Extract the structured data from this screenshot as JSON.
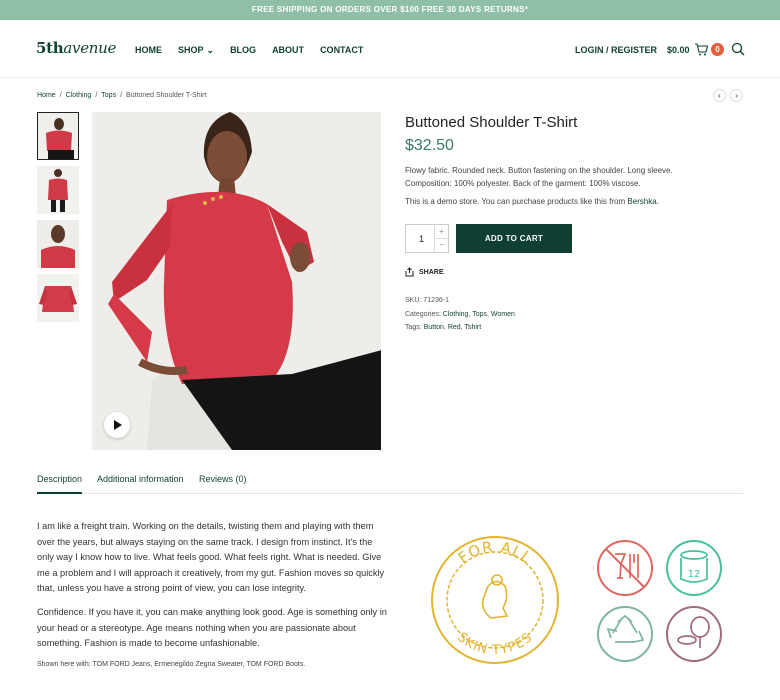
{
  "promo": "FREE SHIPPING ON ORDERS OVER $100 FREE 30 DAYS RETURNS*",
  "header": {
    "logo_main": "5th",
    "logo_italic": "avenue",
    "nav": [
      "HOME",
      "SHOP",
      "BLOG",
      "ABOUT",
      "CONTACT"
    ],
    "login": "LOGIN / REGISTER",
    "cart_total": "$0.00",
    "cart_count": "0"
  },
  "breadcrumb": {
    "items": [
      "Home",
      "Clothing",
      "Tops"
    ],
    "current": "Buttoned Shoulder T-Shirt",
    "sep": "/",
    "prev": "‹",
    "next": "›"
  },
  "product": {
    "title": "Buttoned Shoulder T-Shirt",
    "price": "$32.50",
    "description": "Flowy fabric. Rounded neck. Button fastening on the shoulder. Long sleeve. Composition: 100% polyester. Back of the garment: 100% viscose.",
    "demo_text": "This is a demo store. You can purchase products like this from",
    "demo_link": "Bershka",
    "demo_end": ".",
    "quantity": "1",
    "qty_up": "+",
    "qty_down": "−",
    "add_to_cart": "ADD TO CART",
    "share": "SHARE",
    "sku_label": "SKU:",
    "sku": "71236-1",
    "categories_label": "Categories:",
    "categories": [
      "Clothing",
      "Tops",
      "Women"
    ],
    "tags_label": "Tags:",
    "tags": [
      "Button",
      "Red",
      "Tshirt"
    ]
  },
  "tabs": [
    "Description",
    "Additional information",
    "Reviews (0)"
  ],
  "content": {
    "para1": "I am like a freight train. Working on the details, twisting them and playing with them over the years, but always staying on the same track. I design from instinct. It’s the only way I know how to live. What feels good. What feels right. What is needed. Give me a problem and I will approach it creatively, from my gut. Fashion moves so quickly that, unless you have a strong point of view, you can lose integrity.",
    "para2": "Confidence. If you have it, you can make anything look good. Age is something only in your head or a stereotype. Age means nothing when you are passionate about something. Fashion is made to become unfashionable.",
    "shown_with": "Shown here with: TOM FORD Jeans, Ermenegildo Zegna Sweater, TOM FORD Boots.",
    "seal_top": "FOR ALL",
    "seal_bottom": "SKIN TYPES",
    "jar_number": "12"
  },
  "colors": {
    "brand": "#0f3f33",
    "accent_price": "#3d7a67",
    "promo_bg": "#8fbfa7",
    "badge": "#e45e3f",
    "seal": "#e3b431",
    "icon_red": "#e0675f",
    "icon_green": "#48c09a",
    "icon_teal": "#7fb3a7",
    "icon_mauve": "#a06b80"
  },
  "icons": [
    "cart-icon",
    "search-icon",
    "share-icon",
    "play-icon",
    "no-food-icon",
    "jar-12-icon",
    "recycle-icon",
    "mirror-compact-icon"
  ]
}
